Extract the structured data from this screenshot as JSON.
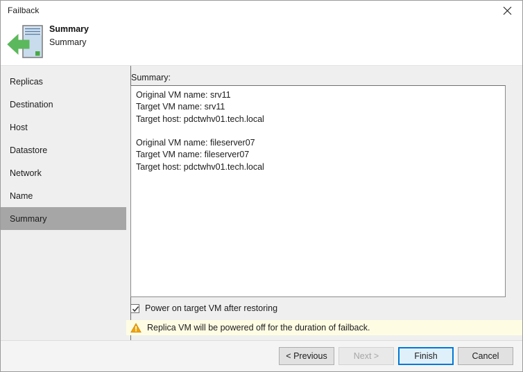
{
  "window": {
    "title": "Failback",
    "close_icon": "close-icon"
  },
  "header": {
    "title": "Summary",
    "subtitle": "Summary",
    "icon": "failback-server-arrow-icon"
  },
  "sidebar": {
    "items": [
      {
        "label": "Replicas",
        "selected": false
      },
      {
        "label": "Destination",
        "selected": false
      },
      {
        "label": "Host",
        "selected": false
      },
      {
        "label": "Datastore",
        "selected": false
      },
      {
        "label": "Network",
        "selected": false
      },
      {
        "label": "Name",
        "selected": false
      },
      {
        "label": "Summary",
        "selected": true
      }
    ]
  },
  "main": {
    "summary_label": "Summary:",
    "summary_text": "Original VM name: srv11\nTarget VM name: srv11\nTarget host: pdctwhv01.tech.local\n\nOriginal VM name: fileserver07\nTarget VM name: fileserver07\nTarget host: pdctwhv01.tech.local",
    "checkbox": {
      "label": "Power on target VM after restoring",
      "checked": true,
      "icon": "checkmark-icon"
    },
    "warning": {
      "text": "Replica VM will be powered off for the duration of failback.",
      "icon": "warning-triangle-icon",
      "background": "#fffce4",
      "icon_color": "#f0a30a"
    }
  },
  "footer": {
    "buttons": [
      {
        "label": "< Previous",
        "state": "enabled"
      },
      {
        "label": "Next >",
        "state": "disabled"
      },
      {
        "label": "Finish",
        "state": "default"
      },
      {
        "label": "Cancel",
        "state": "enabled"
      }
    ]
  },
  "colors": {
    "selected_nav": "#a6a6a6",
    "body_background": "#efefef",
    "accent": "#0078d7",
    "warning_yellow": "#fffce4",
    "icon_green": "#5cb85c"
  }
}
